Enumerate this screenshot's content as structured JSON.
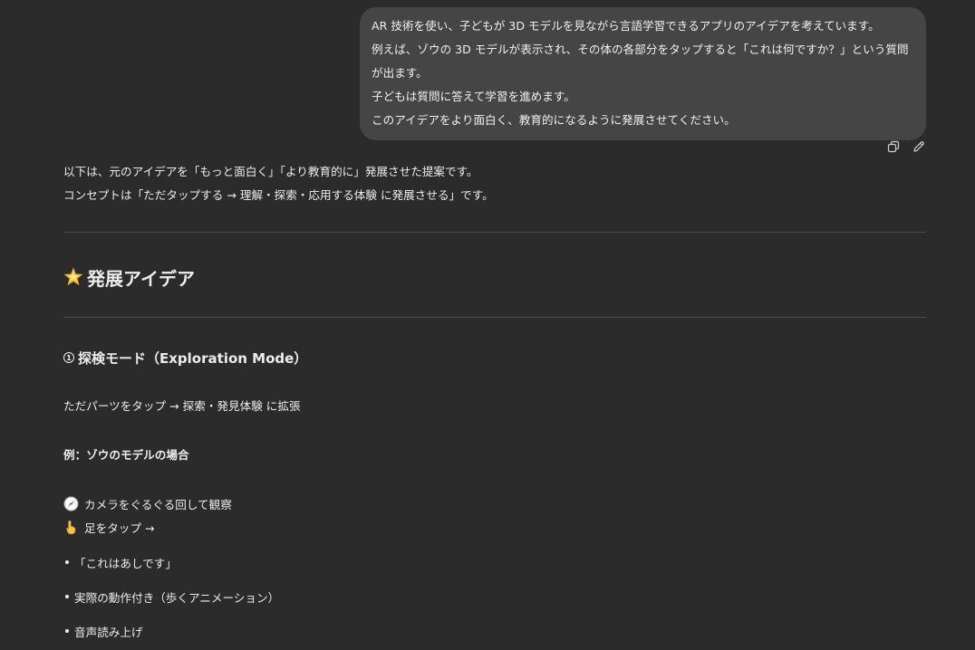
{
  "user_message": {
    "lines": [
      "AR 技術を使い、子どもが 3D モデルを見ながら言語学習できるアプリのアイデアを考えています。",
      "例えば、ゾウの 3D モデルが表示され、その体の各部分をタップすると「これは何ですか？」という質問が出ます。",
      "子どもは質問に答えて学習を進めます。",
      "このアイデアをより面白く、教育的になるように発展させてください。"
    ]
  },
  "message_actions": {
    "copy_icon": "copy-icon",
    "edit_icon": "edit-icon"
  },
  "assistant": {
    "intro": [
      "以下は、元のアイデアを「もっと面白く」「より教育的に」発展させた提案です。",
      "コンセプトは「ただタップする → 理解・探索・応用する体験 に発展させる」です。"
    ],
    "section_title": "発展アイデア",
    "section_icon": "glowing-star-icon",
    "mode_number": "1",
    "mode_title": "探検モード（Exploration Mode）",
    "mode_desc": "ただパーツをタップ → 探索・発見体験 に拡張",
    "example_heading": "例：ゾウのモデルの場合",
    "example_items": [
      {
        "icon": "compass-icon",
        "text": "カメラをぐるぐる回して観察"
      },
      {
        "icon": "pointing-hand-icon",
        "text": "足をタップ →"
      }
    ],
    "bullets": [
      "「これはあしです」",
      "実際の動作付き（歩くアニメーション）",
      "音声読み上げ"
    ]
  },
  "colors": {
    "background": "#2b2b2b",
    "bubble": "#454545",
    "text": "#ececec",
    "divider": "#4a4a4a"
  }
}
